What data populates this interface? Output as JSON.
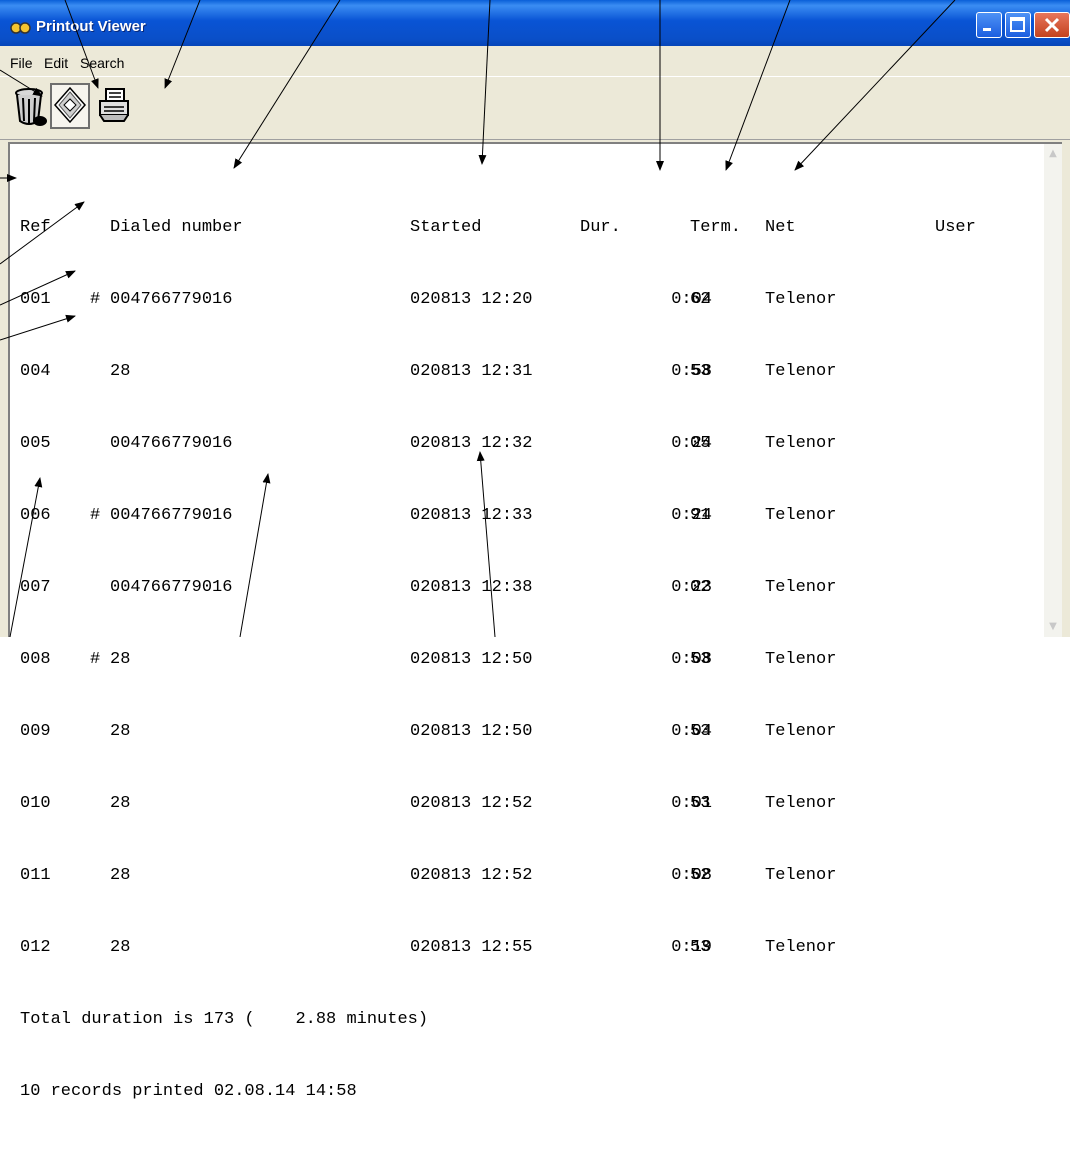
{
  "window": {
    "title": "Printout Viewer",
    "icon": "app-logo-icon",
    "controls": [
      "minimize-icon",
      "maximize-icon",
      "close-icon"
    ]
  },
  "menu": [
    "File",
    "Edit",
    "Search"
  ],
  "toolbar": [
    {
      "icon": "trash-icon"
    },
    {
      "icon": "save-disk-icon"
    },
    {
      "icon": "printer-icon"
    }
  ],
  "report": {
    "headers": {
      "ref": "Ref",
      "dialed": "Dialed number",
      "started": "Started",
      "dur": "Dur.",
      "term": "Term.",
      "net": "Net",
      "user": "User"
    },
    "rows": [
      {
        "ref": "001",
        "mark": "#",
        "dialed": "004766779016",
        "started": "020813 12:20",
        "dur": "0:04",
        "term": "62",
        "net": "Telenor"
      },
      {
        "ref": "004",
        "mark": "",
        "dialed": "28",
        "started": "020813 12:31",
        "dur": "0:58",
        "term": "53",
        "net": "Telenor"
      },
      {
        "ref": "005",
        "mark": "",
        "dialed": "004766779016",
        "started": "020813 12:32",
        "dur": "0:24",
        "term": "05",
        "net": "Telenor"
      },
      {
        "ref": "006",
        "mark": "#",
        "dialed": "004766779016",
        "started": "020813 12:33",
        "dur": "0:24",
        "term": "91",
        "net": "Telenor"
      },
      {
        "ref": "007",
        "mark": "",
        "dialed": "004766779016",
        "started": "020813 12:38",
        "dur": "0:23",
        "term": "02",
        "net": "Telenor"
      },
      {
        "ref": "008",
        "mark": "#",
        "dialed": "28",
        "started": "020813 12:50",
        "dur": "0:08",
        "term": "53",
        "net": "Telenor"
      },
      {
        "ref": "009",
        "mark": "",
        "dialed": "28",
        "started": "020813 12:50",
        "dur": "0:04",
        "term": "53",
        "net": "Telenor"
      },
      {
        "ref": "010",
        "mark": "",
        "dialed": "28",
        "started": "020813 12:52",
        "dur": "0:01",
        "term": "53",
        "net": "Telenor"
      },
      {
        "ref": "011",
        "mark": "",
        "dialed": "28",
        "started": "020813 12:52",
        "dur": "0:08",
        "term": "52",
        "net": "Telenor"
      },
      {
        "ref": "012",
        "mark": "",
        "dialed": "28",
        "started": "020813 12:55",
        "dur": "0:19",
        "term": "53",
        "net": "Telenor"
      }
    ],
    "total_line": "Total duration is 173 (    2.88 minutes)",
    "records_line": "10 records printed 02.08.14 14:58"
  }
}
